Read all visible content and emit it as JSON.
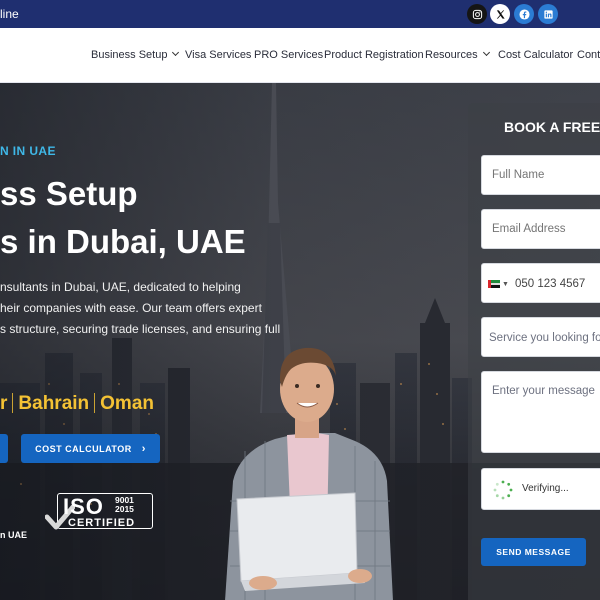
{
  "topbar": {
    "text": "line",
    "social": [
      {
        "icon": "instagram-icon"
      },
      {
        "icon": "x-icon"
      },
      {
        "icon": "facebook-icon"
      },
      {
        "icon": "linkedin-icon"
      }
    ]
  },
  "nav": {
    "items": [
      {
        "label": "Business Setup",
        "dropdown": true
      },
      {
        "label": "Visa Services",
        "dropdown": false
      },
      {
        "label": "PRO Services",
        "dropdown": false
      },
      {
        "label": "Product Registration",
        "dropdown": false
      },
      {
        "label": "Resources",
        "dropdown": true
      },
      {
        "label": "Cost Calculator",
        "dropdown": false
      },
      {
        "label": "Conta",
        "dropdown": false
      }
    ]
  },
  "hero": {
    "eyebrow": "N IN UAE",
    "headline_line1": "ss Setup",
    "headline_line2": "s in Dubai, UAE",
    "paragraph": [
      "nsultants in Dubai, UAE, dedicated to helping",
      "heir companies with ease. Our team offers expert",
      "s structure, securing trade licenses, and ensuring full"
    ],
    "countries": [
      "r",
      "Bahrain",
      "Oman"
    ],
    "cost_calculator_button": "COST CALCULATOR",
    "iso": {
      "word": "ISO",
      "num1": "9001",
      "num2": "2015",
      "certified": "CERTIFIED"
    },
    "small_text": "n UAE"
  },
  "form": {
    "title": "BOOK A FREE",
    "full_name_placeholder": "Full Name",
    "email_placeholder": "Email Address",
    "phone_placeholder": "050 123 4567",
    "service_placeholder": "Service you looking fo",
    "message_placeholder": "Enter your message",
    "captcha_text": "Verifying...",
    "submit_label": "SEND MESSAGE"
  },
  "colors": {
    "topbar": "#1f2f70",
    "accent_blue": "#1565c0",
    "eyebrow": "#3fb8e8",
    "countries": "#f4c234"
  }
}
